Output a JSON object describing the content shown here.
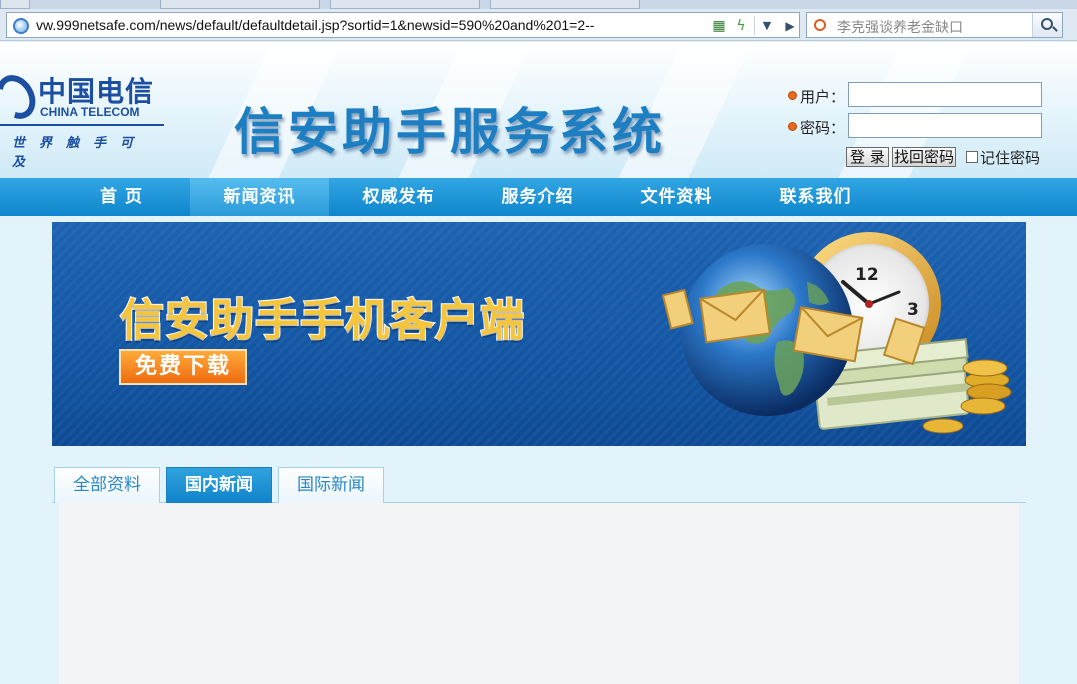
{
  "browser": {
    "url": "vw.999netsafe.com/news/default/defaultdetail.jsp?sortid=1&newsid=590%20and%201=2--",
    "search_placeholder": "李克强谈养老金缺口",
    "icons": [
      "globe-icon",
      "qr-code-icon",
      "lightning-icon",
      "dropdown-arrow-icon",
      "go-arrow-icon",
      "search-icon"
    ]
  },
  "header": {
    "logo": {
      "cn": "中国电信",
      "en": "CHINA TELECOM",
      "slogan": "世界触手可及"
    },
    "site_title": "信安助手服务系统"
  },
  "login": {
    "user_label": "用户：",
    "password_label": "密码：",
    "user_value": "",
    "password_value": "",
    "login_button": "登 录",
    "recover_button": "找回密码",
    "remember_label": "记住密码"
  },
  "nav": {
    "items": [
      {
        "label": "首  页",
        "active": false
      },
      {
        "label": "新闻资讯",
        "active": true
      },
      {
        "label": "权威发布",
        "active": false
      },
      {
        "label": "服务介绍",
        "active": false
      },
      {
        "label": "文件资料",
        "active": false
      },
      {
        "label": "联系我们",
        "active": false
      }
    ]
  },
  "banner": {
    "headline": "信安助手手机客户端",
    "download_label": "免费下载",
    "clock_numbers": [
      "12",
      "3"
    ]
  },
  "tabs": {
    "items": [
      {
        "label": "全部资料",
        "active": false
      },
      {
        "label": "国内新闻",
        "active": true
      },
      {
        "label": "国际新闻",
        "active": false
      }
    ]
  },
  "colors": {
    "nav_blue": "#1d95d8",
    "title_blue": "#1d7fc2",
    "banner_blue": "#1458a6",
    "headline_gold": "#f5c53c",
    "download_orange": "#ef6b10"
  }
}
